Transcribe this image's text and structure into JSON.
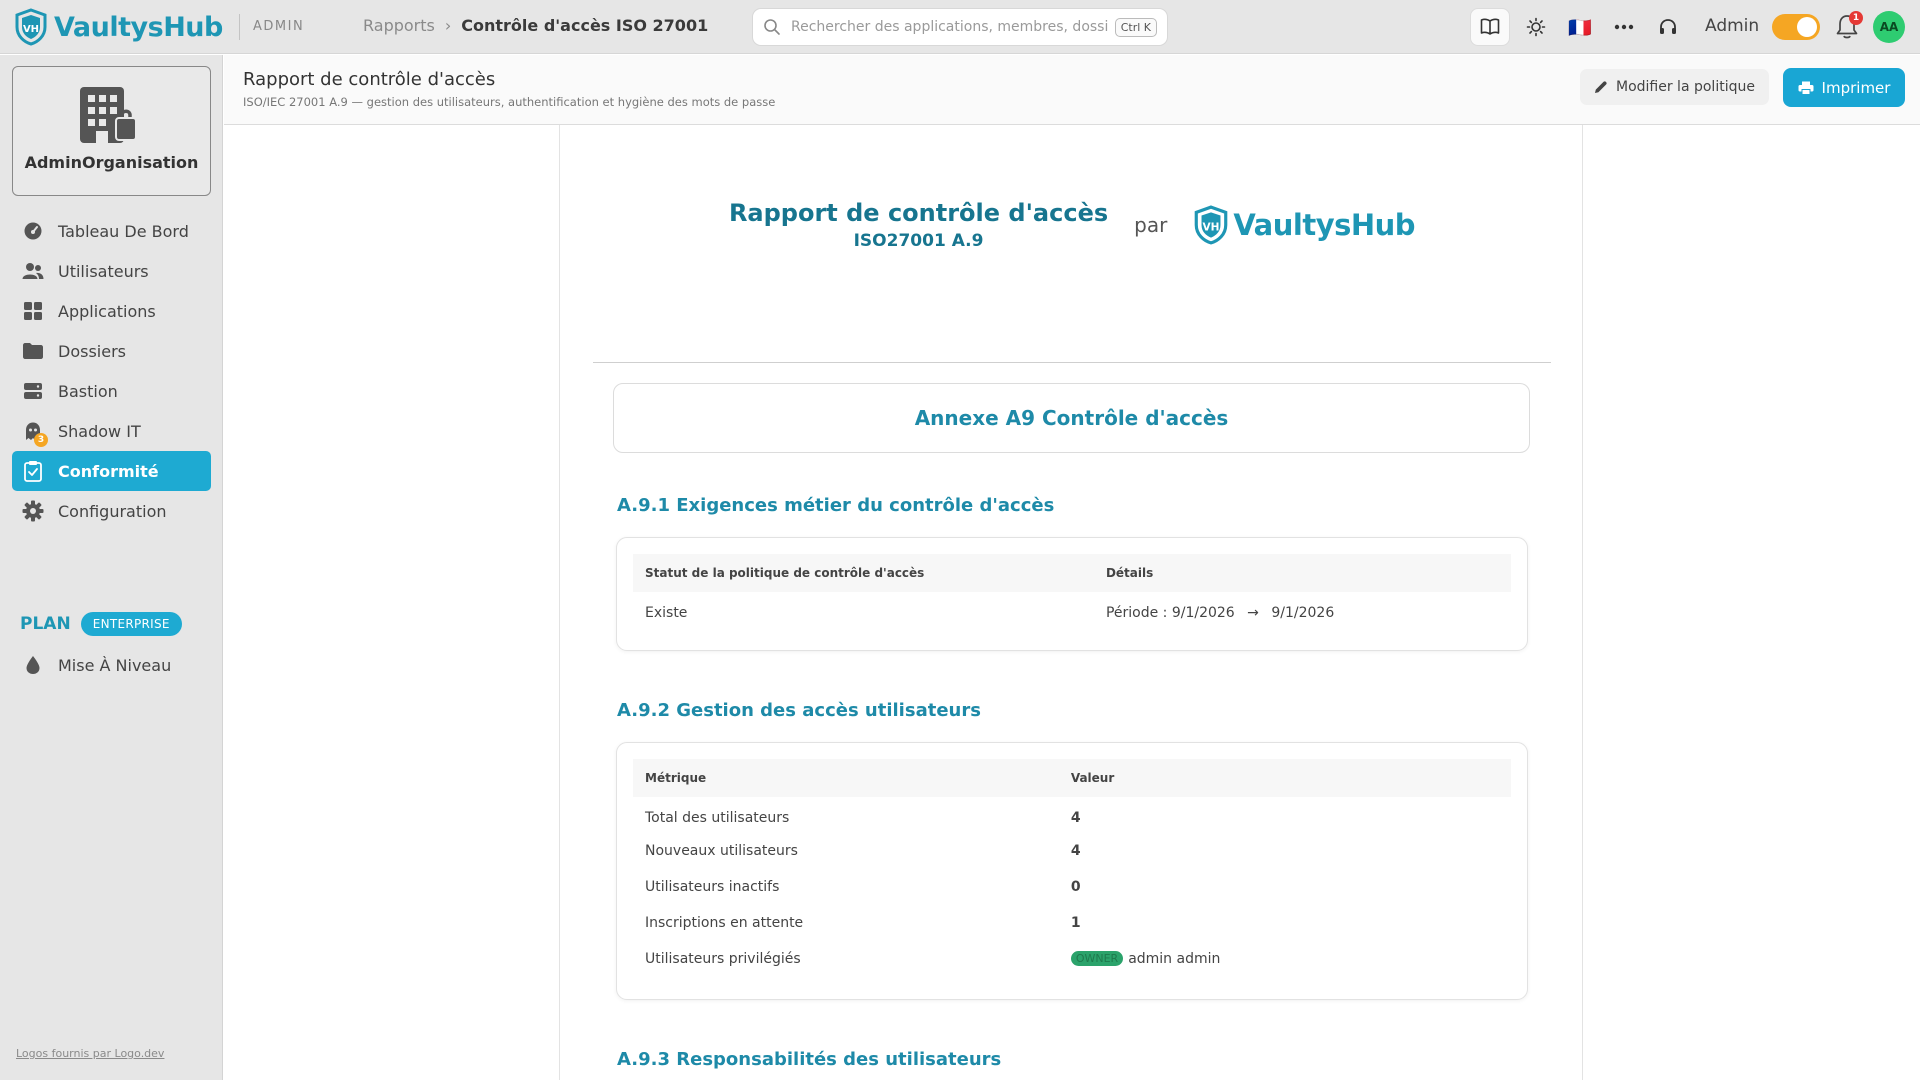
{
  "app": {
    "brand": "VaultysHub",
    "admin_tag": "ADMIN"
  },
  "breadcrumb": {
    "parent": "Rapports",
    "separator": "›",
    "current": "Contrôle d'accès ISO 27001"
  },
  "search": {
    "placeholder": "Rechercher des applications, membres, dossiers",
    "shortcut": "Ctrl K"
  },
  "topbar": {
    "flag": "🇫🇷",
    "user_role": "Admin",
    "notification_count": "1",
    "avatar_initials": "AA",
    "accent_color": "#f5a623"
  },
  "sidebar": {
    "org_name": "AdminOrganisation",
    "items": [
      {
        "label": "Tableau De Bord",
        "icon": "dashboard-icon"
      },
      {
        "label": "Utilisateurs",
        "icon": "users-icon"
      },
      {
        "label": "Applications",
        "icon": "apps-grid-icon"
      },
      {
        "label": "Dossiers",
        "icon": "folder-icon"
      },
      {
        "label": "Bastion",
        "icon": "server-icon"
      },
      {
        "label": "Shadow IT",
        "icon": "ghost-icon",
        "badge": "3"
      },
      {
        "label": "Conformité",
        "icon": "clipboard-check-icon",
        "active": true
      },
      {
        "label": "Configuration",
        "icon": "gear-icon"
      }
    ],
    "plan_label": "PLAN",
    "plan_badge": "ENTERPRISE",
    "upgrade_label": "Mise À Niveau",
    "footer_link": "Logos fournis par Logo.dev",
    "active_color": "#1eaad2"
  },
  "page": {
    "title": "Rapport de contrôle d'accès",
    "subtitle": "ISO/IEC 27001 A.9 — gestion des utilisateurs, authentification et hygiène des mots de passe",
    "edit_label": "Modifier la politique",
    "print_label": "Imprimer"
  },
  "report": {
    "title": "Rapport de contrôle d'accès",
    "subtitle": "ISO27001 A.9",
    "by": "par",
    "brand": "VaultysHub",
    "annex_title": "Annexe A9 Contrôle d'accès",
    "s1": {
      "title": "A.9.1 Exigences métier du contrôle d'accès",
      "col1": "Statut de la politique de contrôle d'accès",
      "col2": "Détails",
      "status": "Existe",
      "period_label": "Période :",
      "period_start": "9/1/2026",
      "period_arrow": "→",
      "period_end": "9/1/2026"
    },
    "s2": {
      "title": "A.9.2 Gestion des accès utilisateurs",
      "col1": "Métrique",
      "col2": "Valeur",
      "rows": [
        {
          "metric": "Total des utilisateurs",
          "value": "4"
        },
        {
          "metric": "Nouveaux utilisateurs",
          "value": "4"
        },
        {
          "metric": "Utilisateurs inactifs",
          "value": "0"
        },
        {
          "metric": "Inscriptions en attente",
          "value": "1"
        },
        {
          "metric": "Utilisateurs privilégiés",
          "badge": "OWNER",
          "value": "admin admin"
        }
      ]
    },
    "s3": {
      "title": "A.9.3 Responsabilités des utilisateurs"
    }
  }
}
